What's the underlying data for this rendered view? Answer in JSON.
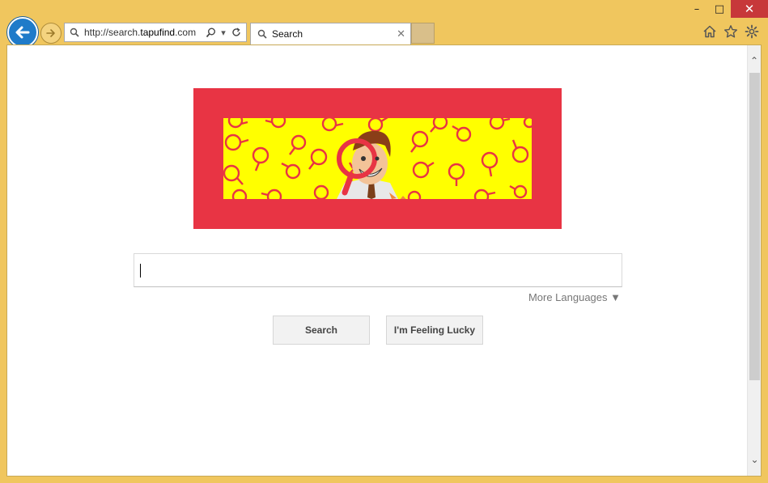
{
  "browser": {
    "url_prefix": "http://search.",
    "url_domain": "tapufind",
    "url_suffix": ".com",
    "tab_title": "Search"
  },
  "page": {
    "search_button_label": "Search",
    "lucky_button_label": "I'm Feeling Lucky",
    "more_languages_label": "More Languages ▼"
  },
  "icons": {
    "minimize": "minimize-icon",
    "maximize": "maximize-icon",
    "close": "close-icon",
    "back": "back-arrow-icon",
    "forward": "forward-arrow-icon",
    "home": "home-icon",
    "favorites": "star-icon",
    "settings": "gear-icon"
  },
  "colors": {
    "frame": "#f0c65e",
    "logo_border": "#e83444",
    "logo_fill": "#ffff00",
    "back_button": "#1f7bc9"
  }
}
